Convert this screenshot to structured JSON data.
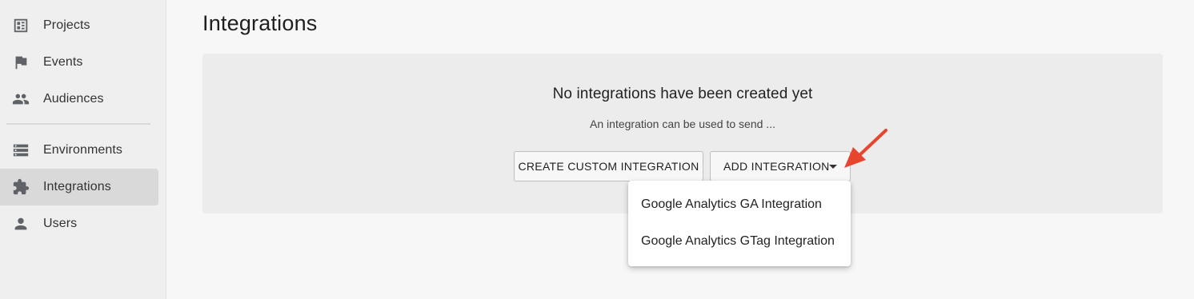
{
  "sidebar": {
    "items": [
      {
        "label": "Projects",
        "icon": "projects-icon"
      },
      {
        "label": "Events",
        "icon": "flag-icon"
      },
      {
        "label": "Audiences",
        "icon": "people-icon"
      },
      {
        "label": "Environments",
        "icon": "storage-icon"
      },
      {
        "label": "Integrations",
        "icon": "puzzle-icon",
        "active": true
      },
      {
        "label": "Users",
        "icon": "person-icon"
      }
    ]
  },
  "main": {
    "title": "Integrations",
    "empty_state": {
      "title": "No integrations have been created yet",
      "subtitle": "An integration can be used to send ..."
    },
    "buttons": {
      "create_custom": "CREATE CUSTOM INTEGRATION",
      "add_integration": "ADD INTEGRATION"
    },
    "dropdown": {
      "items": [
        "Google Analytics GA Integration",
        "Google Analytics GTag Integration"
      ]
    }
  },
  "colors": {
    "annotation_arrow": "#e8452e",
    "active_item_bg": "#d9d9d9"
  }
}
